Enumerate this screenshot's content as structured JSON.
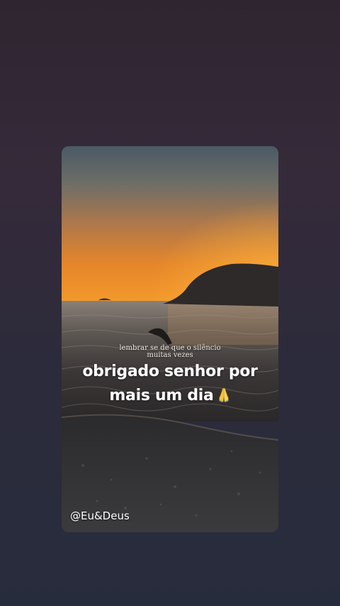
{
  "story": {
    "caption_line1": "lembrar se de que o silêncio",
    "caption_line2": "muitas vezes",
    "main_line1": "obrigado senhor por",
    "main_line2": "mais um dia",
    "emoji_icon": "praying-hands-icon",
    "watermark": "@Eu&Deus"
  },
  "colors": {
    "background_top": "#2f2530",
    "background_bottom": "#272c3c",
    "sunset_orange": "#f08a1c",
    "text": "#ffffff"
  }
}
